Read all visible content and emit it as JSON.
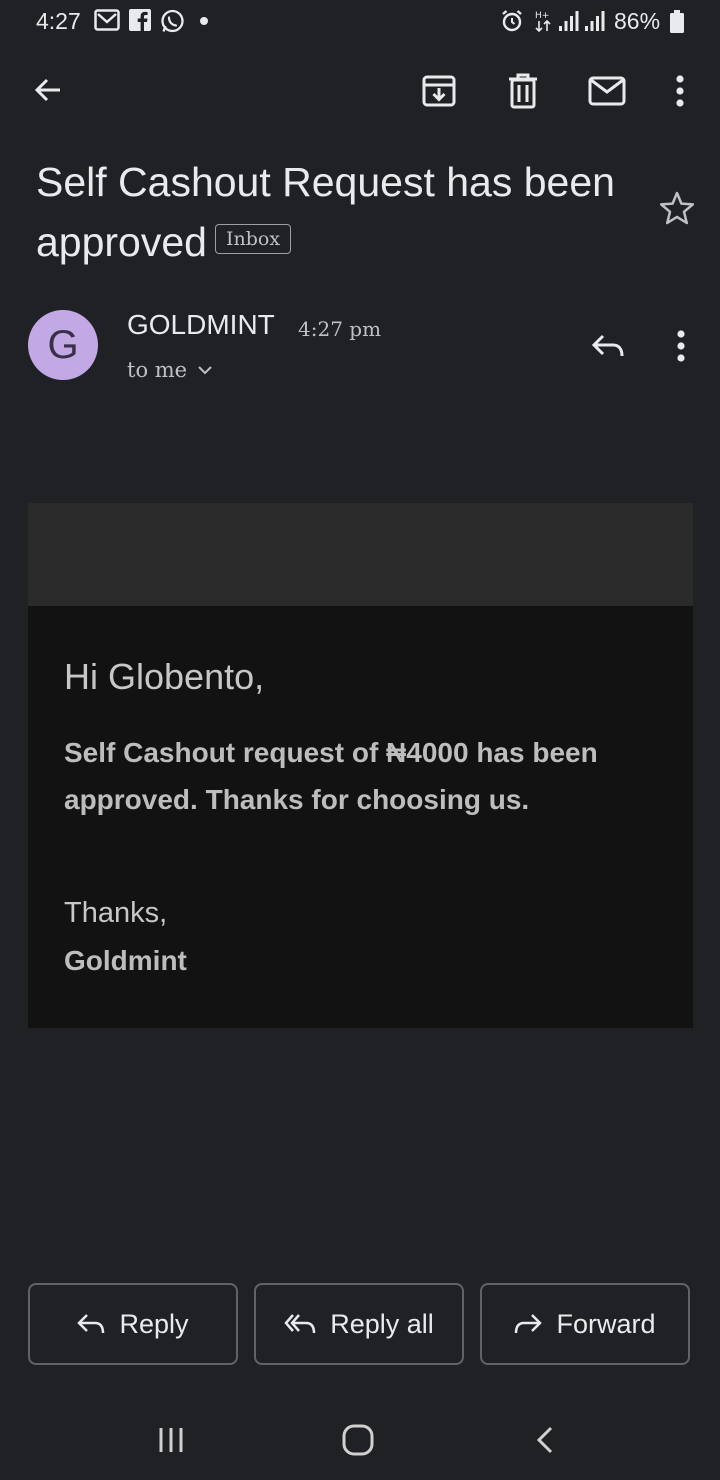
{
  "status_bar": {
    "time": "4:27",
    "battery": "86%",
    "notification_icons": [
      "gmail-icon",
      "facebook-icon",
      "whatsapp-icon",
      "dot-icon"
    ],
    "system_icons": [
      "alarm-icon",
      "data-arrows-icon",
      "signal-icon",
      "signal-icon",
      "battery-icon"
    ]
  },
  "toolbar": {
    "icons": [
      "back-arrow-icon",
      "archive-icon",
      "delete-icon",
      "mark-unread-icon",
      "more-vert-icon"
    ]
  },
  "email": {
    "subject": "Self Cashout Request has been approved",
    "label": "Inbox",
    "sender": {
      "avatar_letter": "G",
      "name": "GOLDMINT",
      "time": "4:27 pm",
      "recipient": "to me"
    },
    "body": {
      "greeting": "Hi Globento,",
      "message": "Self Cashout request of ₦4000 has been approved. Thanks for choosing us.",
      "thanks": "Thanks,",
      "signoff": "Goldmint"
    }
  },
  "actions": {
    "reply": "Reply",
    "reply_all": "Reply all",
    "forward": "Forward"
  },
  "colors": {
    "background": "#202124",
    "avatar": "#c3a8e6",
    "email_body": "#121212"
  }
}
